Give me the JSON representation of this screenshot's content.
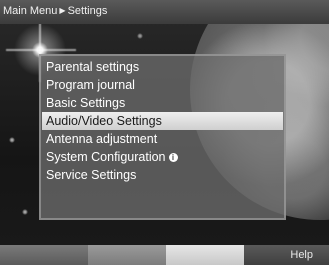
{
  "header": {
    "breadcrumb_root": "Main Menu",
    "breadcrumb_separator": "▶",
    "breadcrumb_current": "Settings"
  },
  "menu": {
    "items": [
      {
        "label": "Parental settings"
      },
      {
        "label": "Program journal"
      },
      {
        "label": "Basic Settings"
      },
      {
        "label": "Audio/Video Settings",
        "selected": true
      },
      {
        "label": "Antenna adjustment"
      },
      {
        "label": "System Configuration",
        "icon": "info-icon"
      },
      {
        "label": "Service Settings"
      }
    ],
    "info_glyph": "i"
  },
  "footer": {
    "keys": [
      {
        "color": "red",
        "label": ""
      },
      {
        "color": "green",
        "label": ""
      },
      {
        "color": "yellow",
        "label": ""
      },
      {
        "color": "blue",
        "label": "Help"
      }
    ]
  }
}
